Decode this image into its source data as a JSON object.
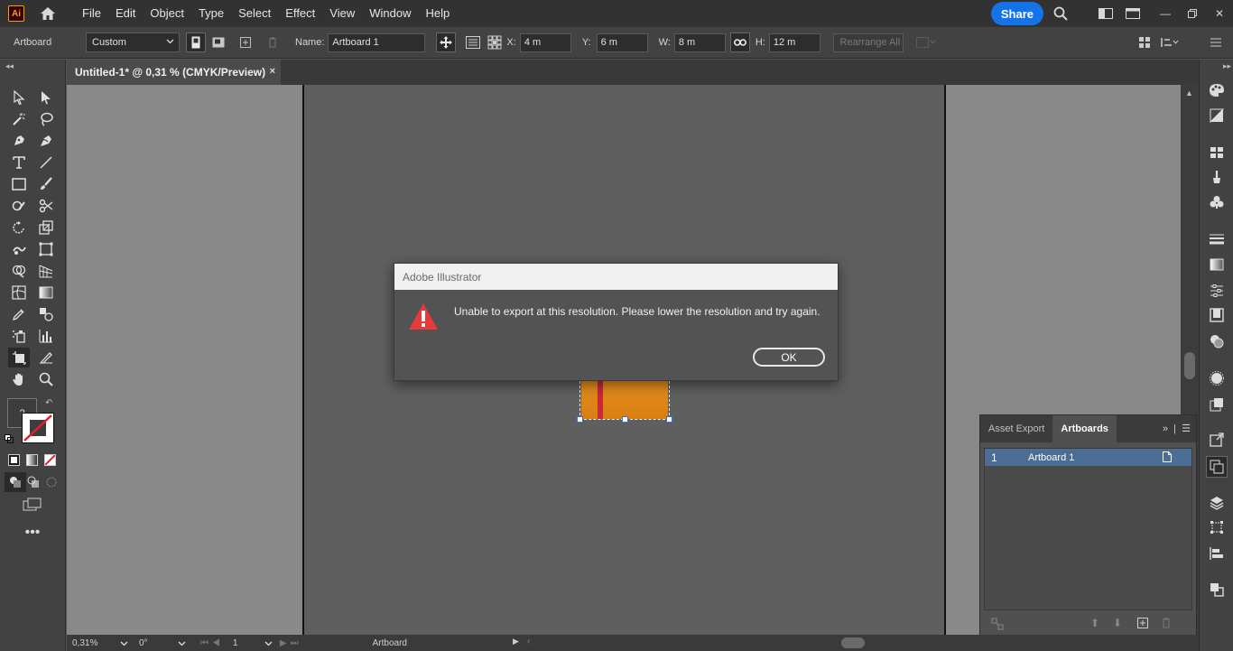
{
  "app": {
    "logo_text": "Ai",
    "menu": [
      "File",
      "Edit",
      "Object",
      "Type",
      "Select",
      "Effect",
      "View",
      "Window",
      "Help"
    ],
    "share_label": "Share"
  },
  "controlbar": {
    "context_label": "Artboard",
    "preset_value": "Custom",
    "name_label": "Name:",
    "name_value": "Artboard 1",
    "x_label": "X:",
    "x_value": "4 m",
    "y_label": "Y:",
    "y_value": "6 m",
    "w_label": "W:",
    "w_value": "8 m",
    "h_label": "H:",
    "h_value": "12 m",
    "rearrange_label": "Rearrange All"
  },
  "document": {
    "tab_title": "Untitled-1* @ 0,31 % (CMYK/Preview)",
    "close_glyph": "×"
  },
  "artboard_object": {
    "fill_color": "#e08a1a",
    "stripe_color": "#c8283a"
  },
  "dialog": {
    "title": "Adobe Illustrator",
    "message": "Unable to export at this resolution. Please lower the resolution and try again.",
    "ok_label": "OK",
    "icon": "warning-icon"
  },
  "artboards_panel": {
    "tabs": [
      "Asset Export",
      "Artboards"
    ],
    "active_tab": "Artboards",
    "rows": [
      {
        "number": "1",
        "name": "Artboard 1"
      }
    ]
  },
  "statusbar": {
    "zoom": "0,31%",
    "rotation": "0°",
    "artboard_index": "1",
    "mode_label": "Artboard"
  }
}
